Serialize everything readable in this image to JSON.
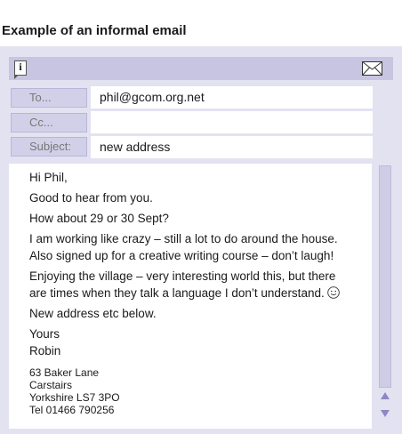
{
  "page_title": "Example of an informal email",
  "titlebar": {
    "info_icon": "info-icon",
    "info_glyph": "i",
    "mail_icon": "envelope-icon"
  },
  "fields": {
    "to": {
      "label": "To...",
      "value": "phil@gcom.org.net"
    },
    "cc": {
      "label": "Cc...",
      "value": ""
    },
    "subject": {
      "label": "Subject:",
      "value": "new address"
    }
  },
  "message": {
    "greeting": "Hi Phil,",
    "line1": "Good to hear from you.",
    "line2": "How about 29 or 30 Sept?",
    "line3": "I am working like crazy – still a lot to do around the house. Also signed up for a creative writing course – don’t laugh!",
    "line4": "Enjoying the village – very interesting world this, but there are times when they talk a language I don’t understand.",
    "smiley_icon": "smiley-icon",
    "line5": "New address etc below.",
    "closing": "Yours",
    "name": "Robin",
    "address": [
      "63 Baker Lane",
      "Carstairs",
      "Yorkshire LS7 3PO",
      "Tel 01466 790256"
    ]
  },
  "colors": {
    "frame": "#e3e2f1",
    "titlebar": "#c7c5e1",
    "label_bg": "#d2d0e8",
    "scroll_arrow": "#8c88c4"
  }
}
